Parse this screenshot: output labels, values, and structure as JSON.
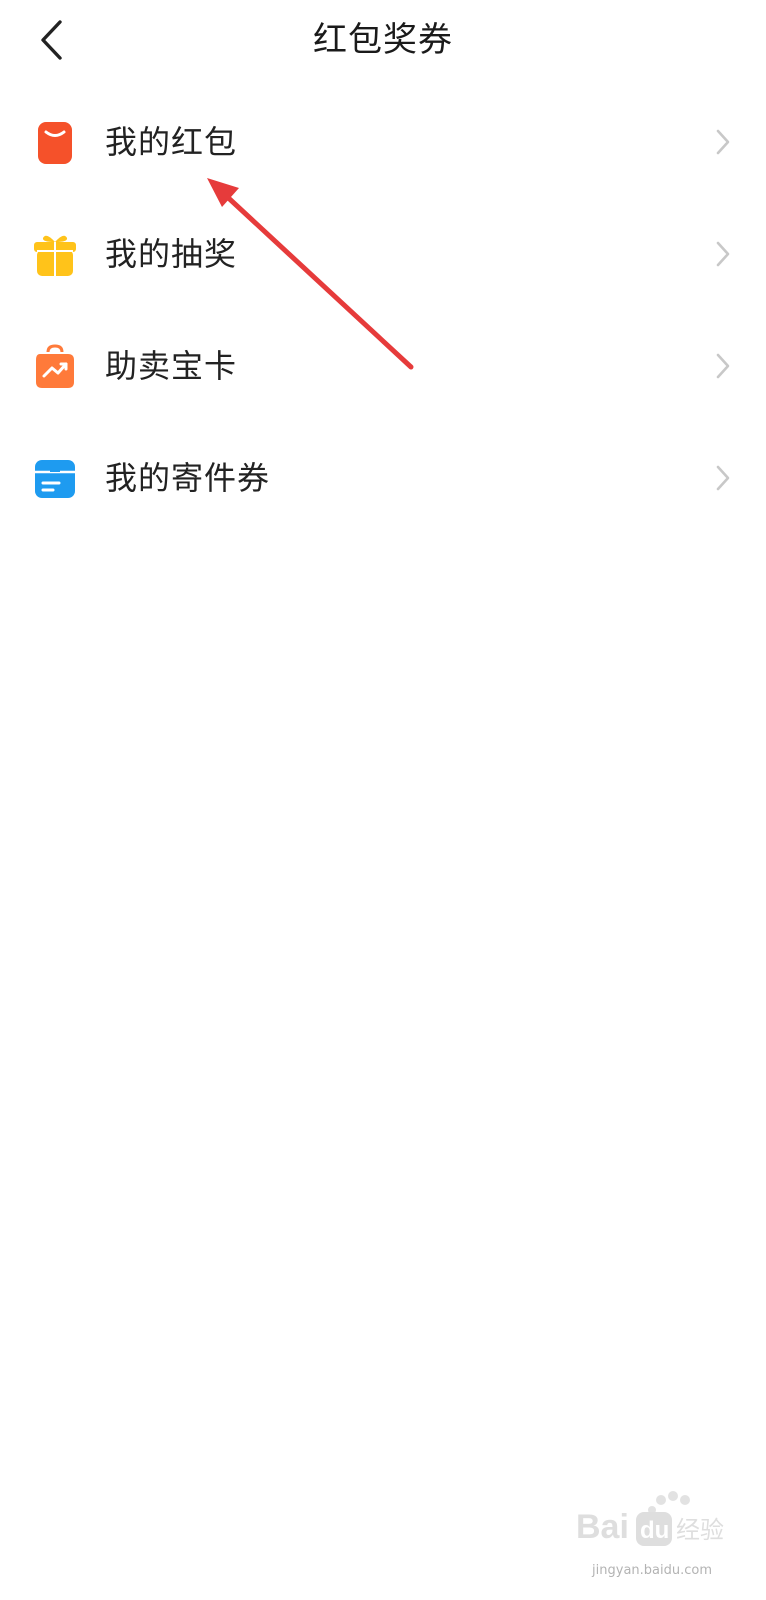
{
  "header": {
    "title": "红包奖券",
    "back_icon": "chevron-left-icon"
  },
  "menu": {
    "items": [
      {
        "label": "我的红包",
        "icon": "red-envelope-icon",
        "color": "#F5512A"
      },
      {
        "label": "我的抽奖",
        "icon": "gift-box-icon",
        "color": "#FFC31A"
      },
      {
        "label": "助卖宝卡",
        "icon": "trend-bag-icon",
        "color": "#FF7A3A"
      },
      {
        "label": "我的寄件券",
        "icon": "package-icon",
        "color": "#1E9BF0"
      }
    ]
  },
  "annotation": {
    "arrow_color": "#E63B3B"
  },
  "watermark": {
    "text": "Bai 经验",
    "sub": "jingyan.baidu.com"
  }
}
